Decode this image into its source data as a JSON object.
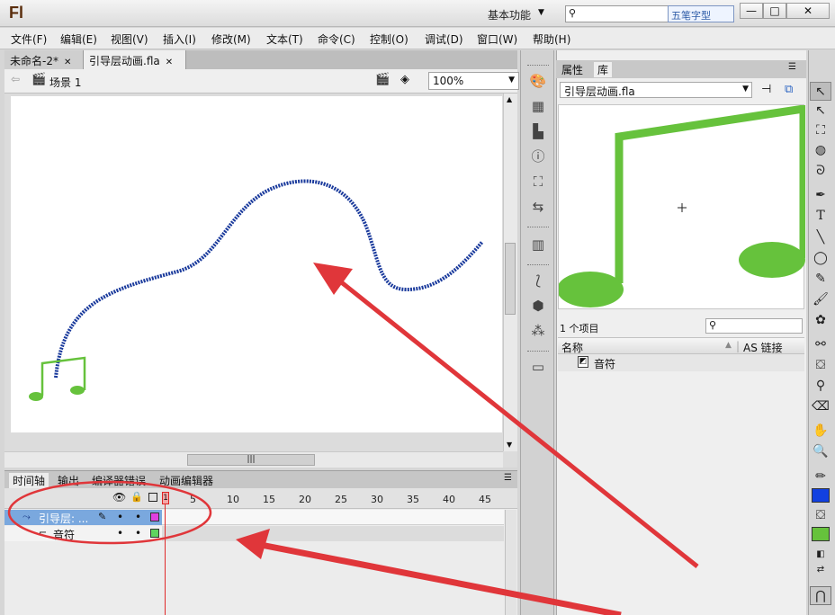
{
  "app": {
    "logo": "Fl",
    "workspace": "基本功能",
    "ime_label": "五笔字型",
    "colors": {
      "annotation": "#e0363a",
      "guide_path": "#1a3a9c",
      "note_green": "#66c23c",
      "layer_selected": "#7aa8de"
    }
  },
  "window_controls": {
    "minimize": "—",
    "maximize": "□",
    "close": "✕"
  },
  "menu": [
    "文件(F)",
    "编辑(E)",
    "视图(V)",
    "插入(I)",
    "修改(M)",
    "文本(T)",
    "命令(C)",
    "控制(O)",
    "调试(D)",
    "窗口(W)",
    "帮助(H)"
  ],
  "doc_tabs": [
    {
      "label": "未命名-2*"
    },
    {
      "label": "引导层动画.fla"
    }
  ],
  "editbar": {
    "scene": "场景 1",
    "zoom": "100%"
  },
  "timeline": {
    "tabs": [
      "时间轴",
      "输出",
      "编译器错误",
      "动画编辑器"
    ],
    "frame_numbers": [
      "1",
      "5",
      "10",
      "15",
      "20",
      "25",
      "30",
      "35",
      "40",
      "45"
    ],
    "current_frame": "1",
    "layers": [
      {
        "name": "引导层: ...",
        "selected": true
      },
      {
        "name": "音符",
        "selected": false
      }
    ]
  },
  "panel": {
    "tabs": [
      "属性",
      "库"
    ],
    "document": "引导层动画.fla",
    "item_count": "1 个项目",
    "columns": {
      "name": "名称",
      "linkage": "AS 链接"
    },
    "items": [
      {
        "name": "音符",
        "icon": "graphic-symbol-icon"
      }
    ]
  }
}
